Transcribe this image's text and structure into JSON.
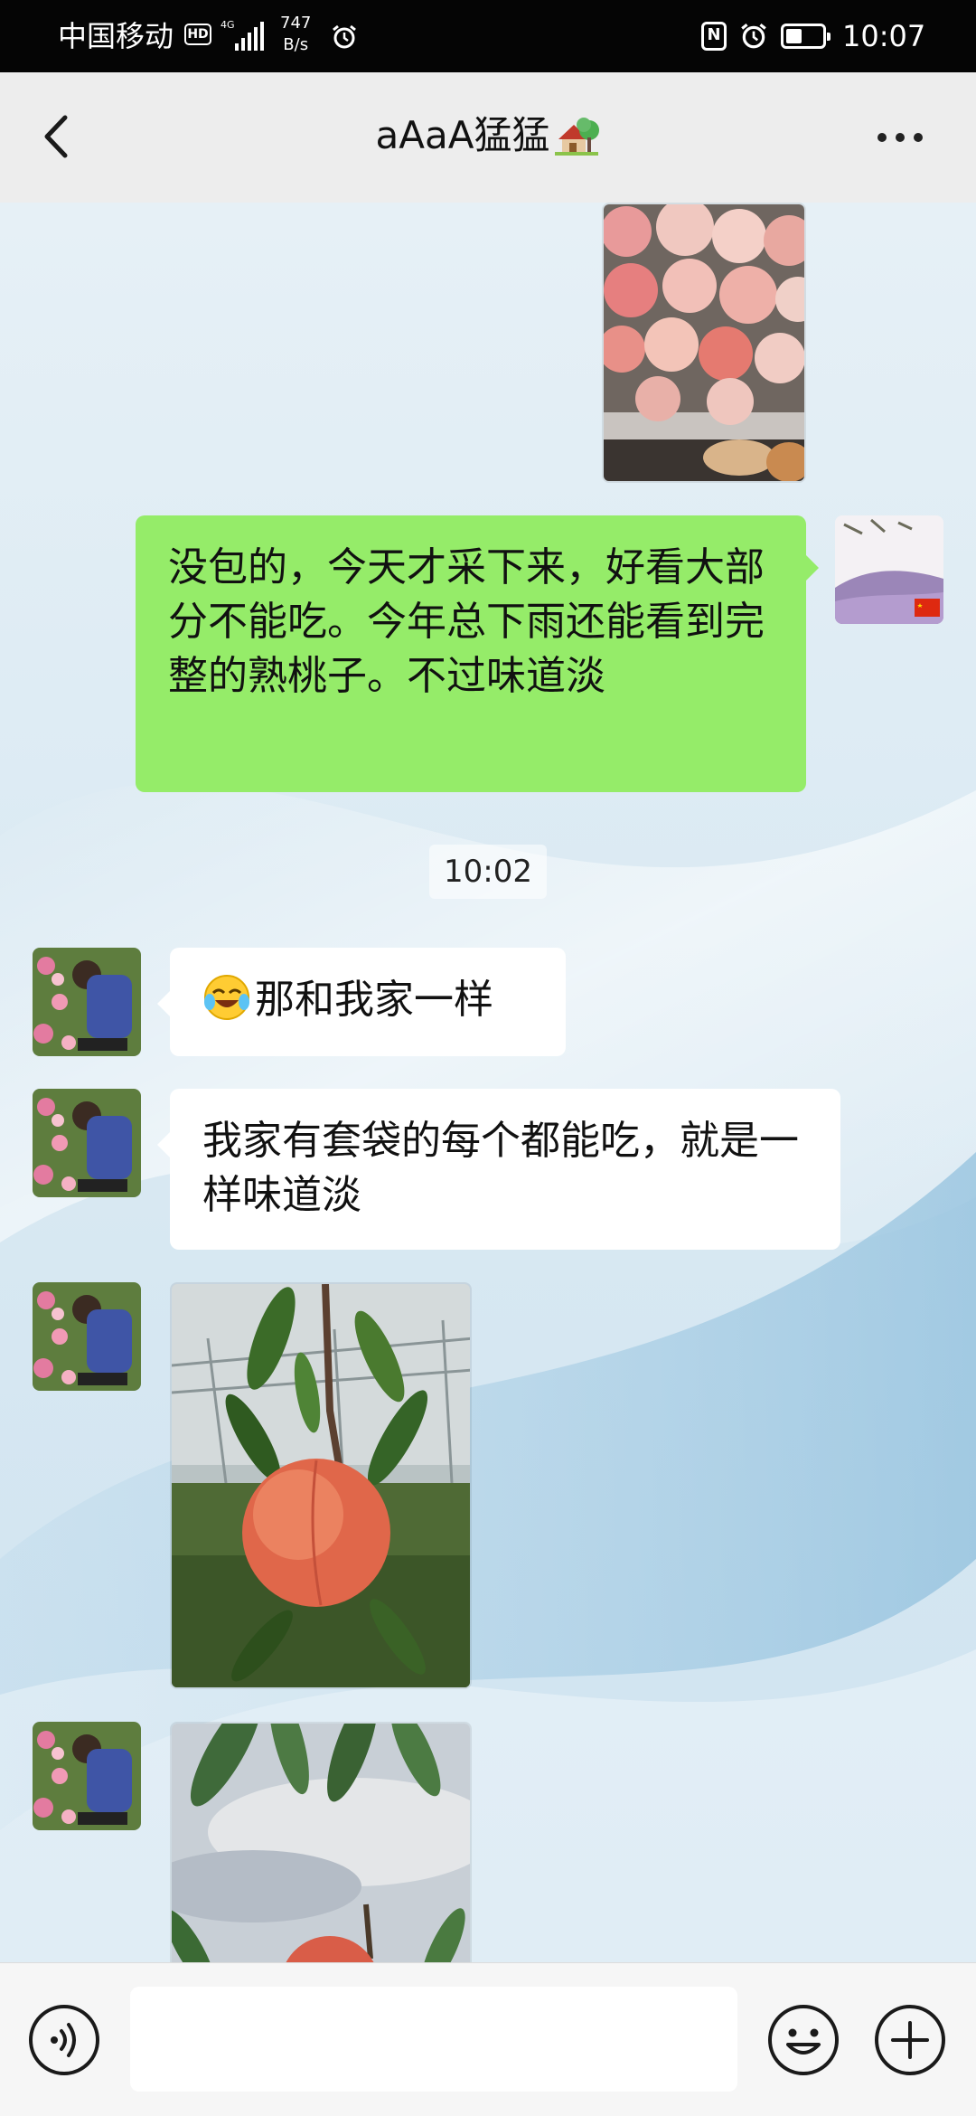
{
  "status_bar": {
    "carrier": "中国移动",
    "hd": "HD",
    "network": "4G",
    "speed_value": "747",
    "speed_unit": "B/s",
    "nfc": "N",
    "time": "10:07",
    "battery_level": 0.45
  },
  "header": {
    "title": "aAaA猛猛",
    "title_emoji": "house-with-garden-icon"
  },
  "messages": [
    {
      "type": "image",
      "side": "sent",
      "content": "peaches on a tray photo"
    },
    {
      "type": "text",
      "side": "sent",
      "text": "没包的，今天才采下来，好看大部分不能吃。今年总下雨还能看到完整的熟桃子。不过味道淡"
    },
    {
      "type": "time",
      "text": "10:02"
    },
    {
      "type": "text",
      "side": "received",
      "emoji": "face-with-tears-of-joy-icon",
      "text": "那和我家一样"
    },
    {
      "type": "text",
      "side": "received",
      "text": "我家有套袋的每个都能吃，就是一样味道淡"
    },
    {
      "type": "image",
      "side": "received",
      "content": "peach on branch photo"
    },
    {
      "type": "image",
      "side": "received",
      "content": "peach on branch against sky photo"
    }
  ],
  "colors": {
    "sent_bubble": "#95ec69",
    "received_bubble": "#ffffff",
    "header_bg": "#ededed",
    "status_bar_bg": "#050505"
  },
  "input_bar": {
    "message_value": "",
    "icons": [
      "voice-icon",
      "emoji-icon",
      "plus-icon"
    ]
  }
}
